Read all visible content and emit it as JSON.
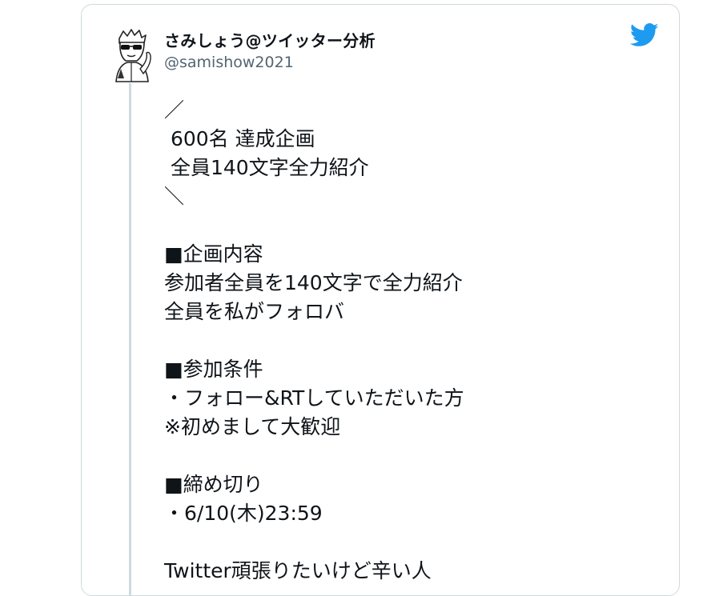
{
  "tweet": {
    "display_name": "さみしょう@ツイッター分析",
    "handle": "@samishow2021",
    "lines": [
      "／",
      " 600名 達成企画",
      " 全員140文字全力紹介",
      "＼",
      "",
      "■企画内容",
      "参加者全員を140文字で全力紹介",
      "全員を私がフォロバ",
      "",
      "■参加条件",
      "・フォロー&RTしていただいた方",
      "※初めまして大歓迎",
      "",
      "■締め切り",
      "・6/10(木)23:59",
      "",
      "Twitter頑張りたいけど辛い人"
    ]
  },
  "icons": {
    "brand": "twitter-bird-icon",
    "avatar": "avatar-illustration"
  },
  "colors": {
    "twitter_blue": "#1d9bf0",
    "border": "#cfd9de",
    "secondary_text": "#536471",
    "text": "#0f1419"
  }
}
